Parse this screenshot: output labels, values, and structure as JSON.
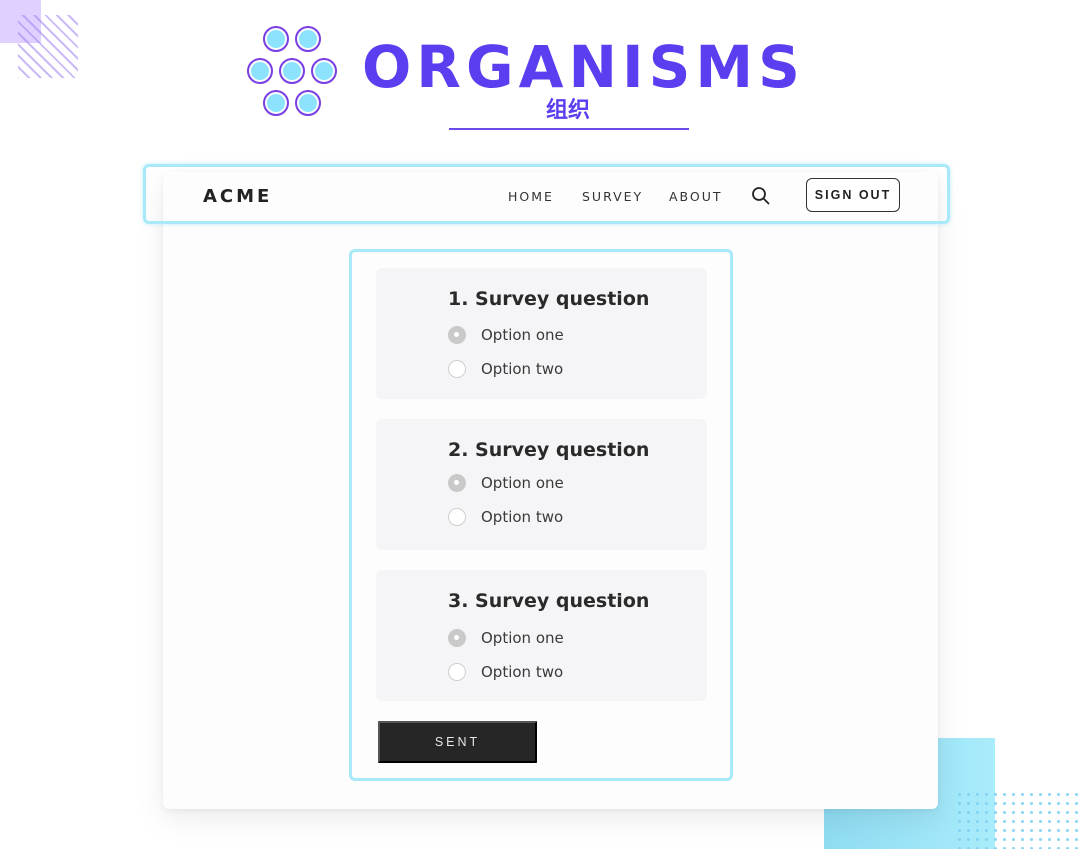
{
  "header": {
    "title": "ORGANISMS",
    "subtitle": "组织"
  },
  "colors": {
    "brand_purple": "#5b3ef0",
    "outline_cyan": "#a7e9f8",
    "cell_fill": "#8ce3fb",
    "button_dark": "#262626"
  },
  "navbar": {
    "brand": "ACME",
    "links": [
      "HOME",
      "SURVEY",
      "ABOUT"
    ],
    "search_icon": "search-icon",
    "signout_label": "SIGN OUT"
  },
  "survey": {
    "questions": [
      {
        "title": "1. Survey question",
        "options": [
          "Option one",
          "Option two"
        ],
        "selected": 0
      },
      {
        "title": "2. Survey question",
        "options": [
          "Option one",
          "Option two"
        ],
        "selected": 0
      },
      {
        "title": "3. Survey question",
        "options": [
          "Option one",
          "Option two"
        ],
        "selected": 0
      }
    ],
    "submit_label": "SENT"
  }
}
